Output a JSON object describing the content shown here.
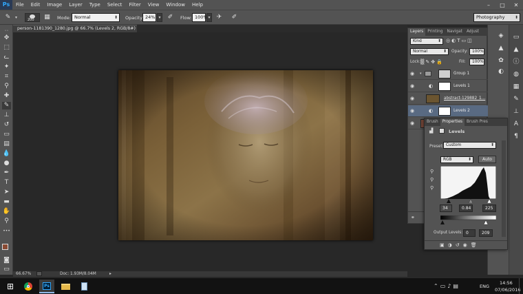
{
  "app": {
    "logo": "Ps"
  },
  "menu": [
    "File",
    "Edit",
    "Image",
    "Layer",
    "Type",
    "Select",
    "Filter",
    "View",
    "Window",
    "Help"
  ],
  "window_controls": {
    "minimize": "–",
    "maximize": "□",
    "close": "✕"
  },
  "options": {
    "brush_size": "200",
    "mode_label": "Mode:",
    "mode_value": "Normal",
    "opacity_label": "Opacity:",
    "opacity_value": "24%",
    "flow_label": "Flow:",
    "flow_value": "100%",
    "workspace": "Photography"
  },
  "document": {
    "tab_title": "person-1181390_1280.jpg @ 66.7% (Levels 2, RGB/8#) *",
    "close": "×"
  },
  "status": {
    "zoom": "66.67%",
    "doc": "Doc: 1.93M/8.04M"
  },
  "layers_panel": {
    "tabs": [
      "Layers",
      "Printing",
      "Navigat",
      "Adjust"
    ],
    "kind": "Kind",
    "blend_mode": "Normal",
    "opacity_label": "Opacity:",
    "opacity_value": "100%",
    "lock_label": "Lock:",
    "fill_label": "Fill:",
    "fill_value": "100%",
    "layers": [
      {
        "name": "Group 1"
      },
      {
        "name": "Levels 1"
      },
      {
        "name": "abstract-129882_1..."
      },
      {
        "name": "Levels 2"
      }
    ]
  },
  "properties_panel": {
    "tabs": [
      "Brush",
      "Properties",
      "Brush Pres"
    ],
    "title": "Levels",
    "preset_label": "Preset:",
    "preset_value": "Custom",
    "channel": "RGB",
    "auto_label": "Auto",
    "input_black": "34",
    "input_gamma": "0.84",
    "input_white": "225",
    "output_label": "Output Levels:",
    "output_black": "0",
    "output_white": "209"
  },
  "taskbar": {
    "language": "ENG",
    "time": "14:56",
    "date": "07/06/2016"
  },
  "colors": {
    "ui_dark": "#535353",
    "canvas_bg": "#282828",
    "selection": "#596a82",
    "accent": "#31a8ff"
  }
}
